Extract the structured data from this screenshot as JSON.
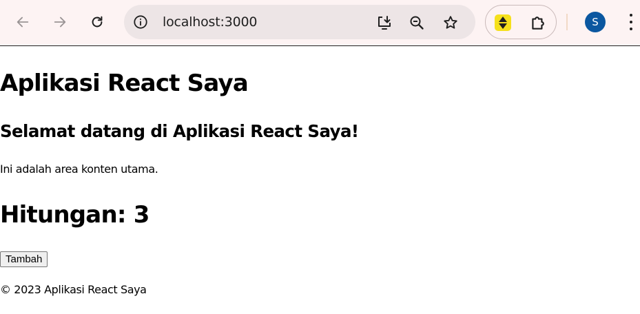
{
  "browser": {
    "url": "localhost:3000",
    "profile_initial": "S",
    "icons": {
      "back": "arrow-left-icon",
      "forward": "arrow-right-icon",
      "reload": "reload-icon",
      "site_info": "info-icon",
      "install": "install-app-icon",
      "zoom": "zoom-icon",
      "bookmark": "star-icon",
      "extension": "extension-yellow-arrows-icon",
      "extensions_menu": "puzzle-icon",
      "menu": "kebab-menu-icon"
    },
    "colors": {
      "toolbar_bg": "#fdf3f3",
      "omnibox_bg": "#ede5e6",
      "avatar_bg": "#0b57a0"
    }
  },
  "page": {
    "title": "Aplikasi React Saya",
    "welcome": "Selamat datang di Aplikasi React Saya!",
    "content_text": "Ini adalah area konten utama.",
    "counter_text": "Hitungan: 3",
    "add_button_label": "Tambah",
    "footer_text": "© 2023 Aplikasi React Saya"
  }
}
